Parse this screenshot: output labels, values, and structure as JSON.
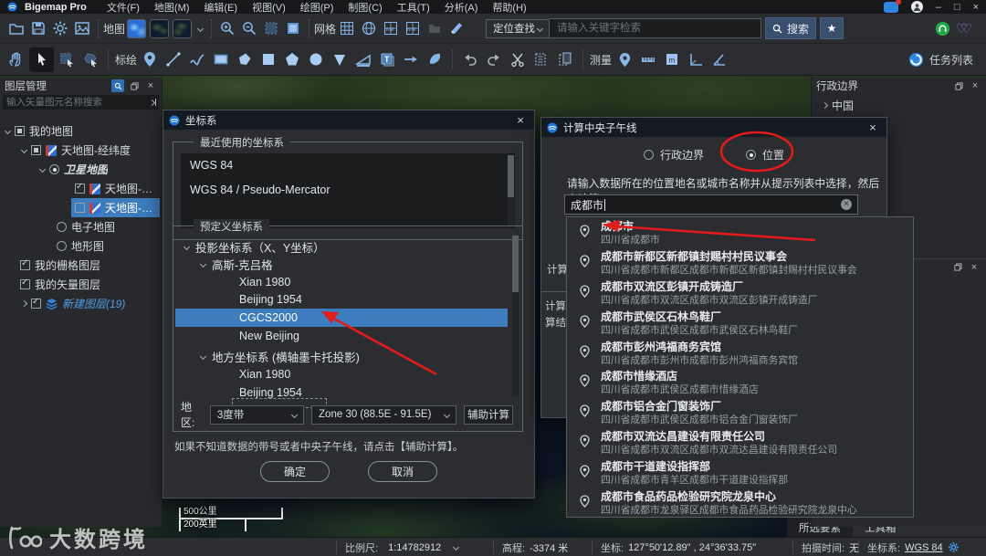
{
  "colors": {
    "accent_blue": "#7fb2e5",
    "selection_blue": "#3d7dbd",
    "annotation_red": "#e21b1b",
    "panel_bg": "#2b2d30",
    "green_badge": "#23a94c"
  },
  "titlebar": {
    "app_title": "Bigemap Pro",
    "menus": [
      "文件(F)",
      "地图(M)",
      "编辑(E)",
      "视图(V)",
      "绘图(P)",
      "制图(C)",
      "工具(T)",
      "分析(A)",
      "帮助(H)"
    ]
  },
  "toolbar": {
    "map_label": "地图",
    "grid_label": "网格",
    "locate_mode": "定位查找",
    "search_placeholder": "请输入关键字检索",
    "search_button": "搜索",
    "plot_label": "标绘",
    "measure_label": "测量",
    "task_list_label": "任务列表"
  },
  "layer_panel": {
    "title": "图层管理",
    "search_placeholder": "输入矢量图元名称搜索",
    "items": [
      {
        "label": "我的地图",
        "state": "partial"
      },
      {
        "label": "天地图-经纬度",
        "state": "partial"
      },
      {
        "label": "卫星地图",
        "state": "radio-on"
      },
      {
        "label": "天地图-卫星地图-...",
        "state": "checked"
      },
      {
        "label": "天地图-卫星地图-...",
        "state": "unchecked",
        "selected": true
      },
      {
        "label": "电子地图",
        "state": "radio-off"
      },
      {
        "label": "地形图",
        "state": "radio-off"
      },
      {
        "label": "我的栅格图层",
        "state": "checked"
      },
      {
        "label": "我的矢量图层",
        "state": "checked"
      },
      {
        "label": "新建图层(19)",
        "state": "checked"
      }
    ]
  },
  "crs_dialog": {
    "title": "坐标系",
    "recent_group": "最近使用的坐标系",
    "recent": [
      "WGS 84",
      "WGS 84 / Pseudo-Mercator"
    ],
    "predefined_group": "预定义坐标系",
    "tree": [
      {
        "label": "投影坐标系（X、Y坐标）"
      },
      {
        "label": "高斯-克吕格"
      },
      {
        "label": "Xian 1980"
      },
      {
        "label": "Beijing 1954"
      },
      {
        "label": "CGCS2000",
        "selected": true
      },
      {
        "label": "New Beijing"
      },
      {
        "label": "地方坐标系 (横轴墨卡托投影)"
      },
      {
        "label": "Xian 1980"
      },
      {
        "label": "Beijing 1954"
      }
    ],
    "region_label": "地区:",
    "band_value": "3度带",
    "zone_value": "Zone 30 (88.5E - 91.5E)",
    "assist_button": "辅助计算",
    "hint": "如果不知道数据的带号或者中央子午线，请点击【辅助计算】。",
    "ok_button": "确定",
    "cancel_button": "取消"
  },
  "meridian_dialog": {
    "title": "计算中央子午线",
    "radio_admin": "行政边界",
    "radio_location": "位置",
    "instruction": "请输入数据所在的位置地名或城市名称并从提示列表中选择，然后点计算：",
    "input_value": "成都市",
    "hidden_fragments": {
      "calc": "计算",
      "line1": "计算中",
      "line2": "算结果"
    },
    "results": [
      {
        "name": "成都市",
        "detail": "四川省成都市"
      },
      {
        "name": "成都市新都区新都镇封赐村村民议事会",
        "detail": "四川省成都市新都区成都市新都区新都镇封赐村村民议事会"
      },
      {
        "name": "成都市双流区彭镇开成铸造厂",
        "detail": "四川省成都市双流区成都市双流区彭镇开成铸造厂"
      },
      {
        "name": "成都市武侯区石林鸟鞋厂",
        "detail": "四川省成都市武侯区成都市武侯区石林鸟鞋厂"
      },
      {
        "name": "成都市彭州鸿福商务宾馆",
        "detail": "四川省成都市彭州市成都市彭州鸿福商务宾馆"
      },
      {
        "name": "成都市惜缘酒店",
        "detail": "四川省成都市武侯区成都市惜缘酒店"
      },
      {
        "name": "成都市铝合金门窗装饰厂",
        "detail": "四川省成都市武侯区成都市铝合金门窗装饰厂"
      },
      {
        "name": "成都市双流达昌建设有限责任公司",
        "detail": "四川省成都市双流区成都市双流达昌建设有限责任公司"
      },
      {
        "name": "成都市干道建设指挥部",
        "detail": "四川省成都市青羊区成都市干道建设指挥部"
      },
      {
        "name": "成都市食品药品检验研究院龙泉中心",
        "detail": "四川省成都市龙泉驿区成都市食品药品检验研究院龙泉中心"
      }
    ]
  },
  "admin_panel": {
    "title": "行政边界",
    "items": [
      "中国"
    ]
  },
  "map_overlay": {
    "scalebar_km": "500公里",
    "scalebar_miles": "200英里",
    "watermark": "大数跨境"
  },
  "bottom_tabs": {
    "selected_features": "所选要素",
    "toolbox": "工具箱"
  },
  "statusbar": {
    "scale_label": "比例尺:",
    "scale_value": "1:14782912",
    "elevation_label": "高程:",
    "elevation_value": "-3374 米",
    "coords_label": "坐标:",
    "coords_value": "127°50'12.89\" , 24°36'33.75\"",
    "capture_label": "拍摄时间:",
    "capture_value": "无",
    "crs_label": "坐标系:",
    "crs_value": "WGS 84"
  },
  "icons": {
    "minimize": "–",
    "maximize": "□",
    "close": "×",
    "star": "★",
    "heart": "♡"
  }
}
